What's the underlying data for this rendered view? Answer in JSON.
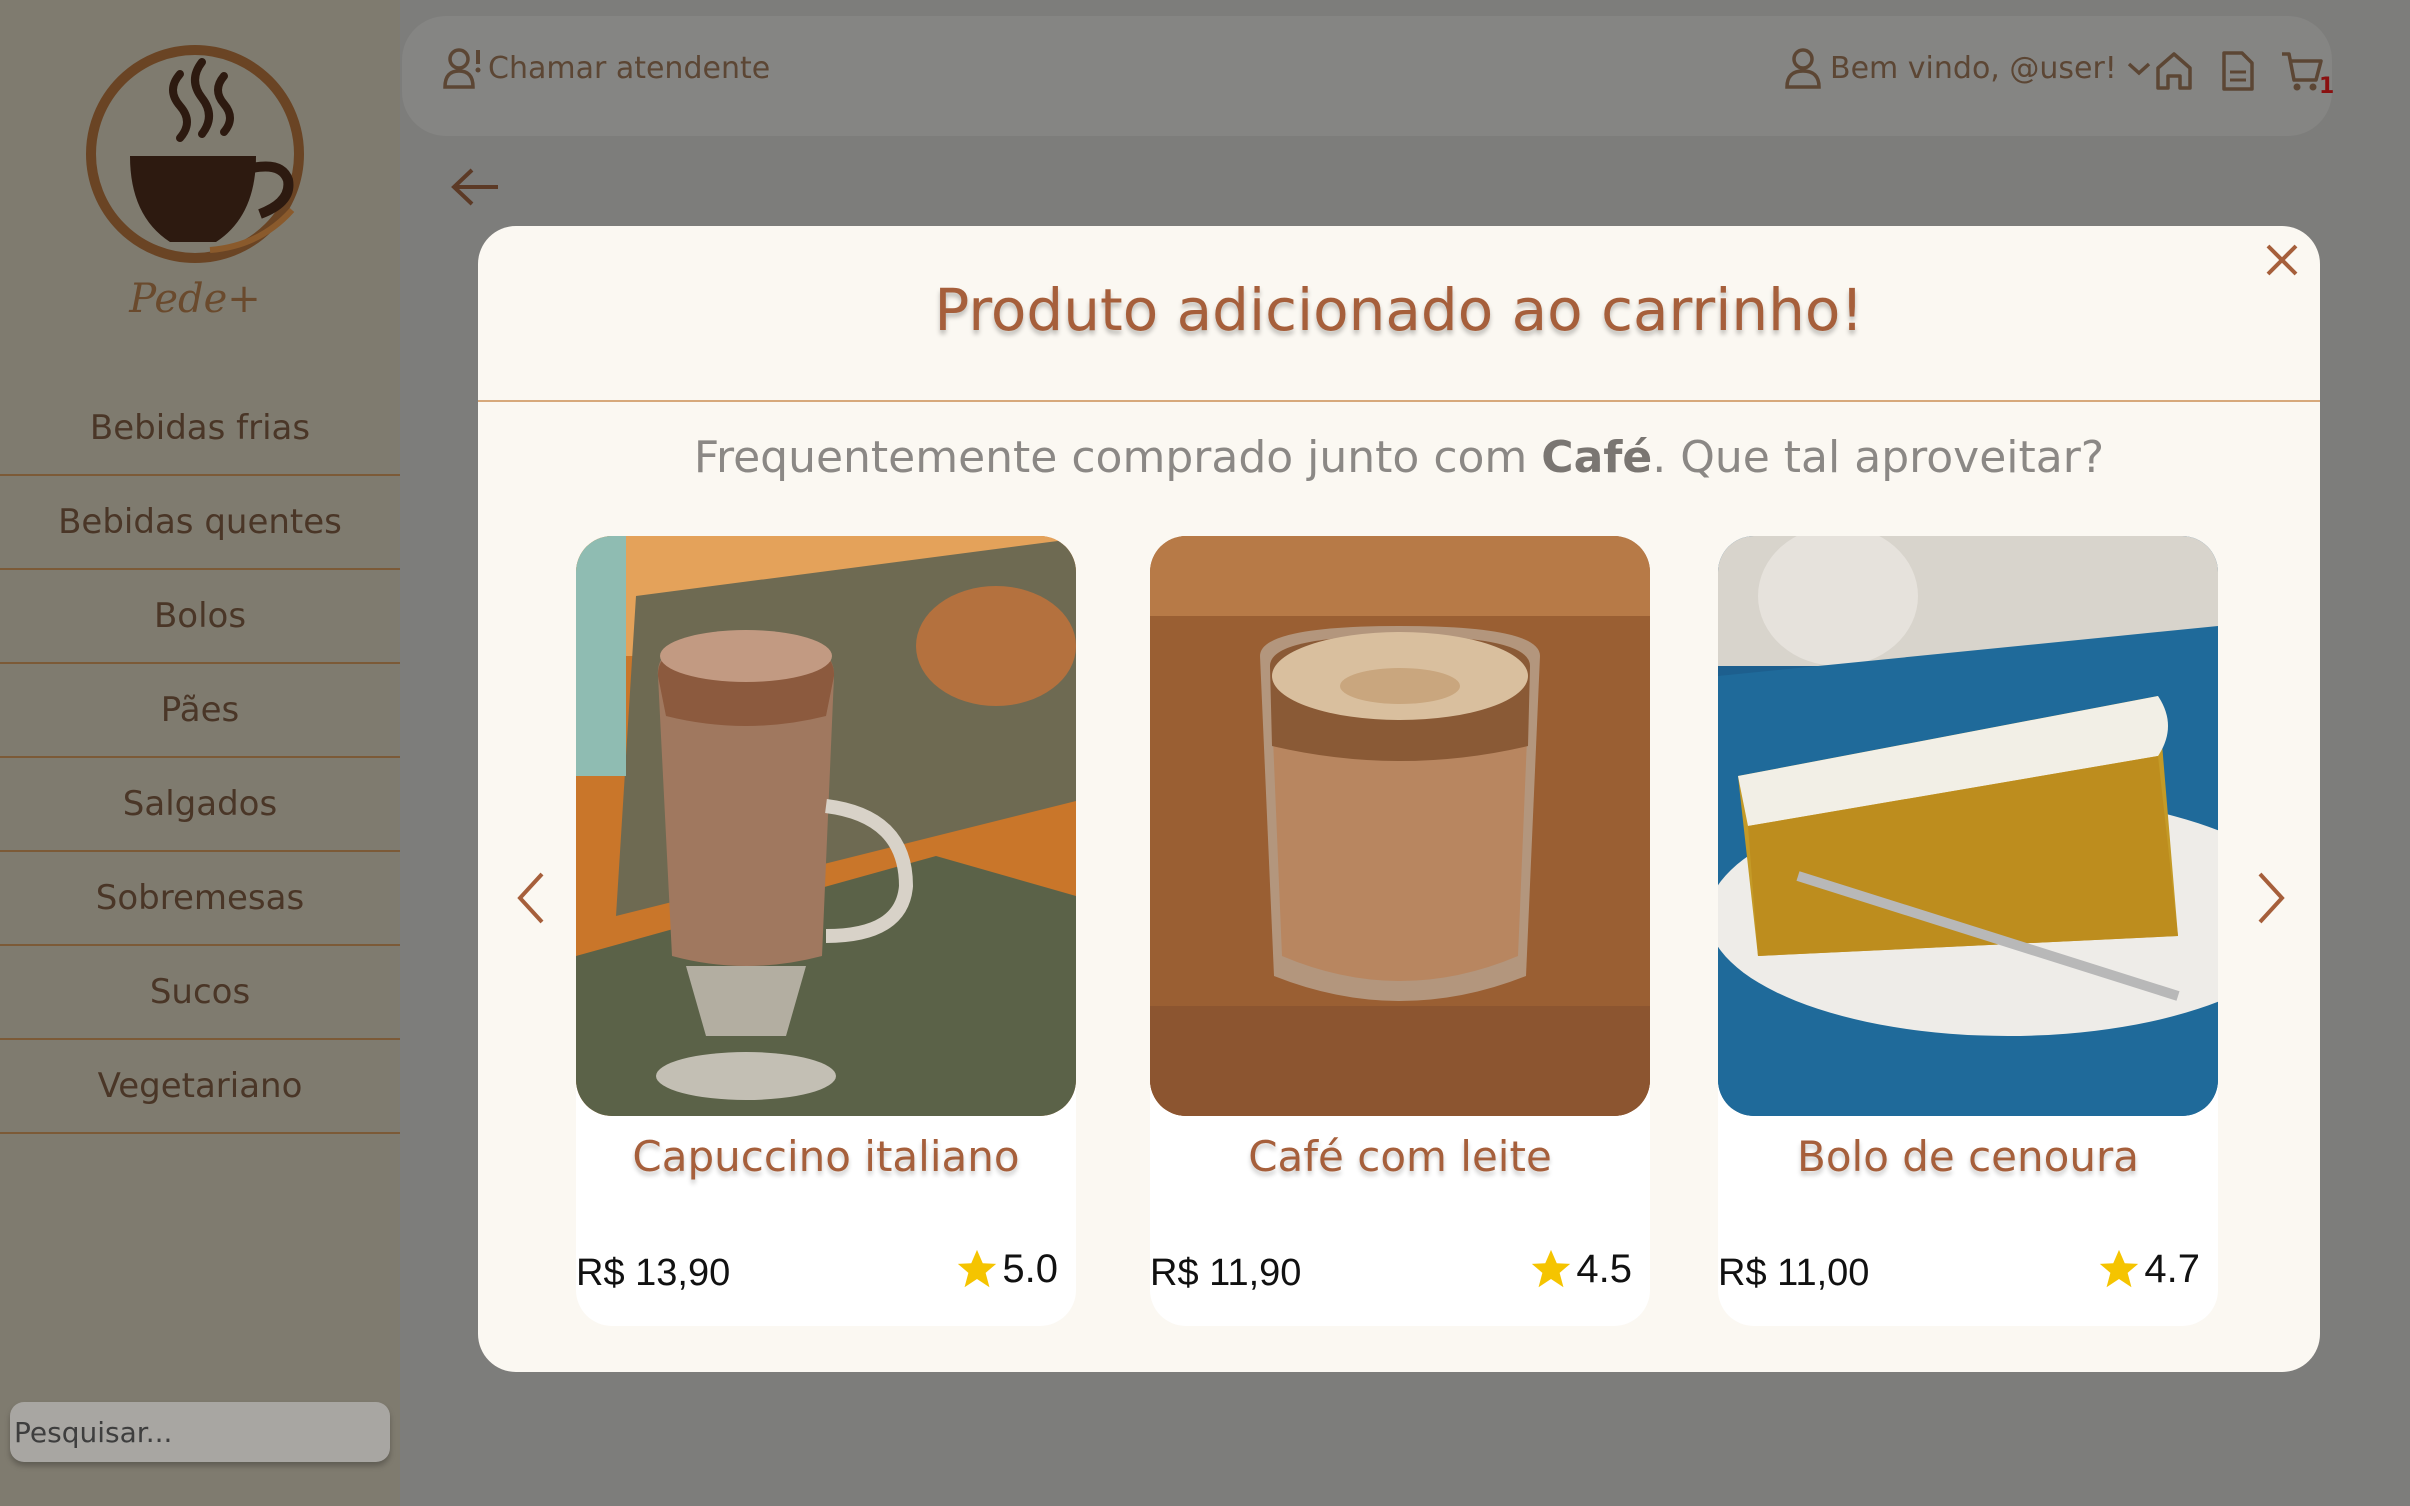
{
  "brand": {
    "name": "Pede+"
  },
  "sidebar": {
    "items": [
      {
        "label": "Bebidas frias"
      },
      {
        "label": "Bebidas quentes"
      },
      {
        "label": "Bolos"
      },
      {
        "label": "Pães"
      },
      {
        "label": "Salgados"
      },
      {
        "label": "Sobremesas"
      },
      {
        "label": "Sucos"
      },
      {
        "label": "Vegetariano"
      }
    ],
    "search_placeholder": "Pesquisar..."
  },
  "header": {
    "call_label": "Chamar atendente",
    "welcome_label": "Bem vindo, @user!",
    "cart_count": "1",
    "icons": [
      "user-alert-icon",
      "user-icon",
      "chevron-down-icon",
      "home-icon",
      "document-icon",
      "cart-icon"
    ]
  },
  "modal": {
    "title": "Produto adicionado ao carrinho!",
    "subtitle_prefix": "Frequentemente comprado junto com ",
    "subtitle_product": "Café",
    "subtitle_suffix": ". Que tal aproveitar?",
    "products": [
      {
        "name": "Capuccino italiano",
        "price": "R$ 13,90",
        "rating": "5.0"
      },
      {
        "name": "Café com leite",
        "price": "R$ 11,90",
        "rating": "4.5"
      },
      {
        "name": "Bolo de cenoura",
        "price": "R$ 11,00",
        "rating": "4.7"
      }
    ]
  },
  "colors": {
    "accent": "#a65f3b",
    "star": "#f5c400",
    "modal_bg": "#fbf8f2",
    "overlay": "#7d7d7b"
  }
}
